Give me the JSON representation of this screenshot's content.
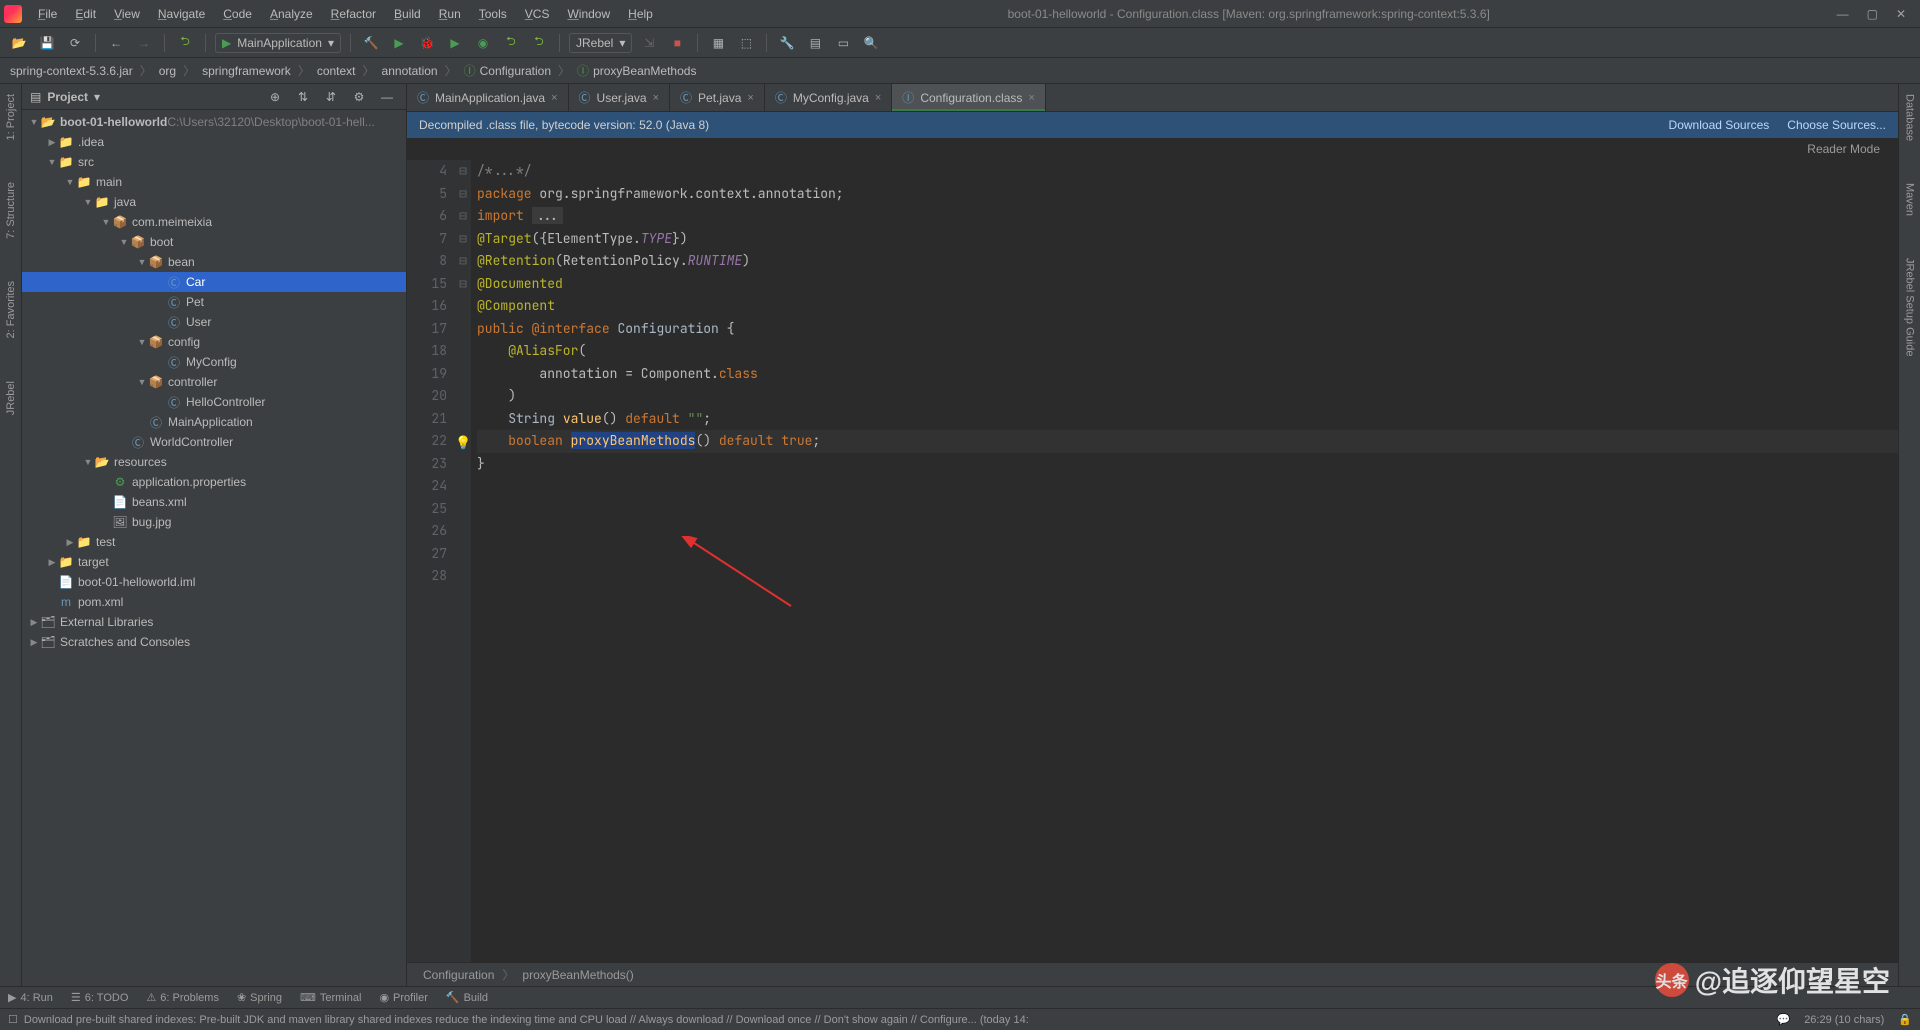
{
  "title": "boot-01-helloworld - Configuration.class [Maven: org.springframework:spring-context:5.3.6]",
  "menu": [
    "File",
    "Edit",
    "View",
    "Navigate",
    "Code",
    "Analyze",
    "Refactor",
    "Build",
    "Run",
    "Tools",
    "VCS",
    "Window",
    "Help"
  ],
  "runConfig": "MainApplication",
  "jrebel": "JRebel",
  "breadcrumbs": [
    "spring-context-5.3.6.jar",
    "org",
    "springframework",
    "context",
    "annotation",
    "Configuration",
    "proxyBeanMethods"
  ],
  "projectPanel": {
    "title": "Project"
  },
  "tree": {
    "root": "boot-01-helloworld",
    "rootPath": "C:\\Users\\32120\\Desktop\\boot-01-hell...",
    "nodes": [
      {
        "label": ".idea",
        "depth": 1,
        "arrow": "▶",
        "icon": "📁",
        "cls": "folder-gray"
      },
      {
        "label": "src",
        "depth": 1,
        "arrow": "▼",
        "icon": "📁",
        "cls": "folder"
      },
      {
        "label": "main",
        "depth": 2,
        "arrow": "▼",
        "icon": "📁",
        "cls": "folder"
      },
      {
        "label": "java",
        "depth": 3,
        "arrow": "▼",
        "icon": "📁",
        "cls": "folder"
      },
      {
        "label": "com.meimeixia",
        "depth": 4,
        "arrow": "▼",
        "icon": "📦",
        "cls": "folder-gray"
      },
      {
        "label": "boot",
        "depth": 5,
        "arrow": "▼",
        "icon": "📦",
        "cls": "folder-gray"
      },
      {
        "label": "bean",
        "depth": 6,
        "arrow": "▼",
        "icon": "📦",
        "cls": "folder-gray"
      },
      {
        "label": "Car",
        "depth": 7,
        "arrow": "",
        "icon": "Ⓒ",
        "cls": "file-blue",
        "selected": true
      },
      {
        "label": "Pet",
        "depth": 7,
        "arrow": "",
        "icon": "Ⓒ",
        "cls": "file-blue"
      },
      {
        "label": "User",
        "depth": 7,
        "arrow": "",
        "icon": "Ⓒ",
        "cls": "file-blue"
      },
      {
        "label": "config",
        "depth": 6,
        "arrow": "▼",
        "icon": "📦",
        "cls": "folder-gray"
      },
      {
        "label": "MyConfig",
        "depth": 7,
        "arrow": "",
        "icon": "Ⓒ",
        "cls": "file-blue"
      },
      {
        "label": "controller",
        "depth": 6,
        "arrow": "▼",
        "icon": "📦",
        "cls": "folder-gray"
      },
      {
        "label": "HelloController",
        "depth": 7,
        "arrow": "",
        "icon": "Ⓒ",
        "cls": "file-blue"
      },
      {
        "label": "MainApplication",
        "depth": 6,
        "arrow": "",
        "icon": "Ⓒ",
        "cls": "file-blue"
      },
      {
        "label": "WorldController",
        "depth": 5,
        "arrow": "",
        "icon": "Ⓒ",
        "cls": "file-blue"
      },
      {
        "label": "resources",
        "depth": 3,
        "arrow": "▼",
        "icon": "📂",
        "cls": "folder"
      },
      {
        "label": "application.properties",
        "depth": 4,
        "arrow": "",
        "icon": "⚙",
        "cls": "file-green"
      },
      {
        "label": "beans.xml",
        "depth": 4,
        "arrow": "",
        "icon": "📄",
        "cls": "file-orange"
      },
      {
        "label": "bug.jpg",
        "depth": 4,
        "arrow": "",
        "icon": "🖼",
        "cls": "folder-gray"
      },
      {
        "label": "test",
        "depth": 2,
        "arrow": "▶",
        "icon": "📁",
        "cls": "folder"
      },
      {
        "label": "target",
        "depth": 1,
        "arrow": "▶",
        "icon": "📁",
        "cls": "file-orange"
      },
      {
        "label": "boot-01-helloworld.iml",
        "depth": 1,
        "arrow": "",
        "icon": "📄",
        "cls": "folder-gray"
      },
      {
        "label": "pom.xml",
        "depth": 1,
        "arrow": "",
        "icon": "m",
        "cls": "file-blue"
      }
    ],
    "external": "External Libraries",
    "scratches": "Scratches and Consoles"
  },
  "tabs": [
    {
      "label": "MainApplication.java",
      "icon": "Ⓒ",
      "active": false
    },
    {
      "label": "User.java",
      "icon": "Ⓒ",
      "active": false
    },
    {
      "label": "Pet.java",
      "icon": "Ⓒ",
      "active": false
    },
    {
      "label": "MyConfig.java",
      "icon": "Ⓒ",
      "active": false
    },
    {
      "label": "Configuration.class",
      "icon": "Ⓘ",
      "active": true
    }
  ],
  "banner": {
    "text": "Decompiled .class file, bytecode version: 52.0 (Java 8)",
    "link1": "Download Sources",
    "link2": "Choose Sources..."
  },
  "readerMode": "Reader Mode",
  "code": {
    "startLine": 4,
    "lines": [
      {
        "n": 4,
        "html": "<span class='cmt'>/*...*/</span>"
      },
      {
        "n": 5,
        "html": ""
      },
      {
        "n": 6,
        "html": "<span class='kw'>package</span> org.springframework.context.annotation;"
      },
      {
        "n": 7,
        "html": ""
      },
      {
        "n": 8,
        "html": "<span class='kw'>import</span> <span style='background:#3b3b3b;padding:0 4px'>...</span>"
      },
      {
        "n": 15,
        "html": ""
      },
      {
        "n": 16,
        "html": "<span class='ann'>@Target</span>({ElementType.<span class='id-i'>TYPE</span>})"
      },
      {
        "n": 17,
        "html": "<span class='ann'>@Retention</span>(RetentionPolicy.<span class='id-i'>RUNTIME</span>)"
      },
      {
        "n": 18,
        "html": "<span class='ann'>@Documented</span>"
      },
      {
        "n": 19,
        "html": "<span class='ann'>@Component</span>"
      },
      {
        "n": 20,
        "html": "<span class='kw'>public</span> <span class='kw'>@interface</span> <span class='cls'>Configuration</span> {"
      },
      {
        "n": 21,
        "html": "    <span class='ann'>@AliasFor</span>("
      },
      {
        "n": 22,
        "html": "        annotation = Component.<span class='kw'>class</span>"
      },
      {
        "n": 23,
        "html": "    )"
      },
      {
        "n": 24,
        "html": "    <span class='cls'>String</span> <span class='fn'>value</span>() <span class='kw'>default</span> <span class='str'>\"\"</span>;"
      },
      {
        "n": 25,
        "html": ""
      },
      {
        "n": 26,
        "html": "    <span class='kw'>boolean</span> <span class='hl'>proxyBeanMethods</span>() <span class='kw'>default</span> <span class='kw'>true</span>;",
        "hl": true,
        "bulb": true
      },
      {
        "n": 27,
        "html": "}"
      },
      {
        "n": 28,
        "html": ""
      }
    ]
  },
  "editorCrumbs": [
    "Configuration",
    "proxyBeanMethods()"
  ],
  "toolWindows": [
    "Run",
    "TODO",
    "Problems",
    "Spring",
    "Terminal",
    "Profiler",
    "Build"
  ],
  "status": {
    "msg": "Download pre-built shared indexes: Pre-built JDK and maven library shared indexes reduce the indexing time and CPU load // Always download // Download once // Don't show again // Configure... (today 14:",
    "pos": "26:29 (10 chars)"
  },
  "leftTabs": [
    "Project",
    "Structure",
    "Favorites",
    "JRebel"
  ],
  "rightTabs": [
    "Database",
    "Maven",
    "JRebel Setup Guide"
  ],
  "watermark": "@追逐仰望星空"
}
